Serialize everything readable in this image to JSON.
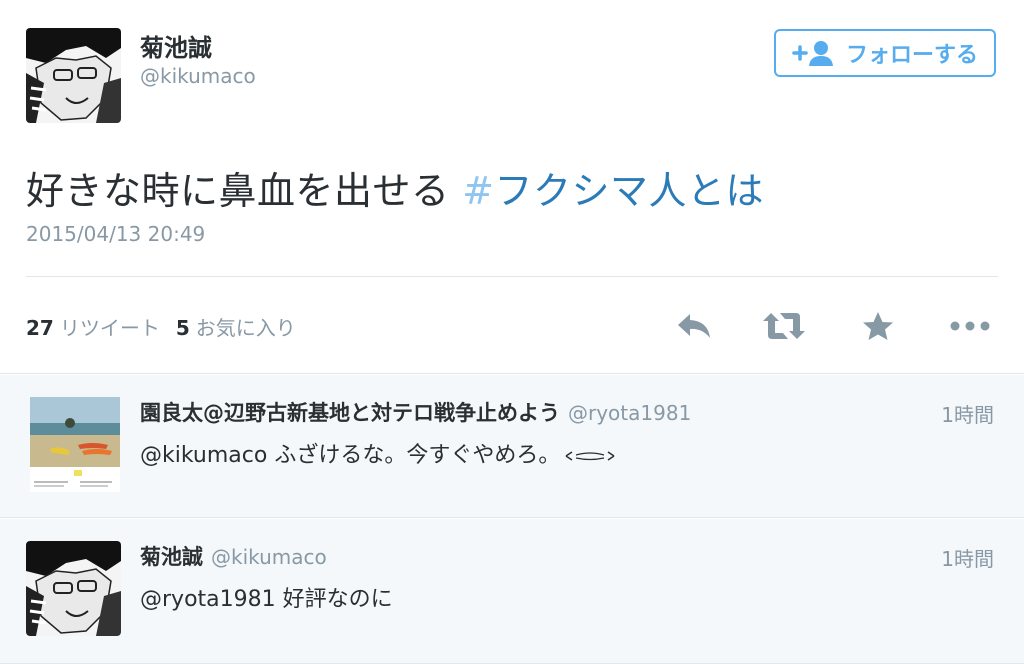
{
  "tweet": {
    "author_name": "菊池誠",
    "author_handle": "@kikumaco",
    "follow_label": "フォローする",
    "text": "好きな時に鼻血を出せる ",
    "hashtag_mark": "#",
    "hashtag_text": "フクシマ人とは",
    "timestamp": "2015/04/13 20:49",
    "retweet_count": "27",
    "retweet_label": "リツイート",
    "favorite_count": "5",
    "favorite_label": "お気に入り",
    "icons": [
      "reply-icon",
      "retweet-icon",
      "star-icon",
      "more-icon"
    ]
  },
  "replies": [
    {
      "name": "園良太@辺野古新基地と対テロ戦争止めよう",
      "handle": "@ryota1981",
      "time": "1時間",
      "mention": "@kikumaco",
      "text": " ふざけるな。今すぐやめろ。"
    },
    {
      "name": "菊池誠",
      "handle": "@kikumaco",
      "time": "1時間",
      "mention": "@ryota1981",
      "text": " 好評なのに"
    }
  ],
  "colors": {
    "accent": "#55acee",
    "hashtag": "#2b7bb9",
    "muted": "#8899a6",
    "text": "#292f33"
  }
}
